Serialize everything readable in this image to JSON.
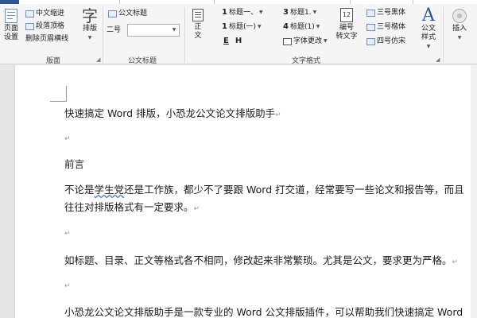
{
  "ribbon": {
    "layout_group": {
      "label": "版面",
      "page_setup_lines": [
        "页面",
        "设置"
      ],
      "indent": "中文缩进",
      "paragraph_grid": "段落顶格",
      "delete_header_line": "删除页眉横线",
      "typeset_label": "排版",
      "typeset_icon_glyph": "字"
    },
    "doc_title_group": {
      "label": "公文标题",
      "title_style": "公文标题",
      "size_value": "二号",
      "size_input_value": ""
    },
    "text_format_group": {
      "label": "文字格式",
      "body_lines": [
        "正",
        "文"
      ],
      "heading1_num": "1",
      "heading1": "标题一、",
      "heading2_num": "1",
      "heading2": "标题(一)",
      "heading3_num": "3",
      "heading3": "标题1.",
      "heading4_num": "4",
      "heading4": "标题(1)",
      "font_change": "字体更改",
      "numbering_lines": [
        "编号",
        "转文字"
      ],
      "size3_black": "三号黑体",
      "size3_kai": "三号楷体",
      "size4_fang": "四号仿宋",
      "doc_style_lines": [
        "公文",
        "样式"
      ],
      "style_icon_glyph": "A"
    },
    "insert_group": {
      "insert_label": "插入"
    }
  },
  "document": {
    "title": "快速搞定 Word 排版，小恐龙公文论文排版助手",
    "preface_heading": "前言",
    "para1_before": "不论是",
    "para1_wavy": "学生党",
    "para1_after": "还是工作族，都少不了要跟 Word 打交道，经常要写一些论文和报告等，而且",
    "para1_line2": "往往对排版格式有一定要求。",
    "para2": "如标题、目录、正文等格式各不相同，修改起来非常繁琐。尤其是公文，要求更为严格。",
    "para3": "小恐龙公文论文排版助手是一款专业的 Word 公文排版插件，可以帮助我们快速搞定 Word",
    "paragraph_mark": "↵"
  },
  "colors": {
    "accent": "#2b579a",
    "ribbon_bg": "#f5f5f5",
    "page_bg": "#ffffff",
    "canvas_bg": "#e6e6e6"
  }
}
